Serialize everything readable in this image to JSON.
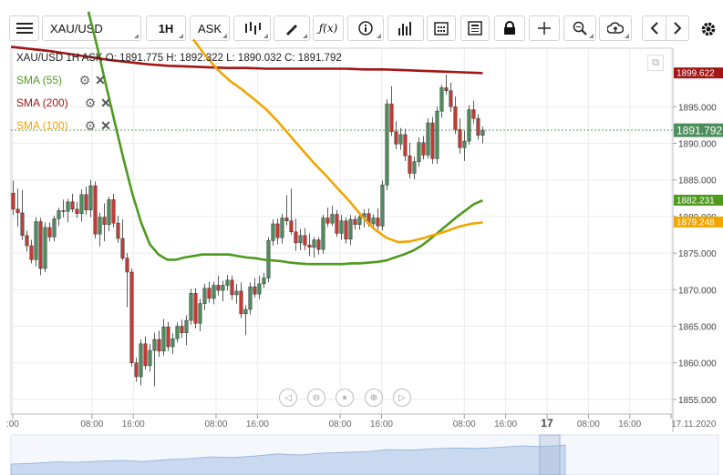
{
  "toolbar": {
    "symbol": "XAU/USD",
    "timeframe": "1H",
    "price_type": "ASK"
  },
  "ohlc_line": "XAU/USD 1H ASK  O: 1891.775 H: 1892.322 L: 1890.032 C: 1891.792",
  "legend": [
    {
      "name": "SMA (55)",
      "color": "#4e9a1e"
    },
    {
      "name": "SMA (200)",
      "color": "#a31515"
    },
    {
      "name": "SMA (100)",
      "color": "#f0a500"
    }
  ],
  "chart_data": {
    "type": "candlestick",
    "title": "XAU/USD 1H ASK",
    "ylim": [
      1853,
      1903
    ],
    "y_ticks": [
      1855,
      1860,
      1865,
      1870,
      1875,
      1880,
      1885,
      1890,
      1895
    ],
    "y_tick_labels": [
      "1855.000",
      "1860.000",
      "1865.000",
      "1870.000",
      "1875.000",
      "1880.000",
      "1885.000",
      "1890.000",
      "1895.000"
    ],
    "x_tick_labels": [
      ":00",
      "08:00",
      "16:00",
      "08:00",
      "16:00",
      "08:00",
      "16:00",
      "08:00",
      "16:00",
      "17",
      "08:00",
      "16:00",
      "17.11.2020"
    ],
    "x_tick_index": [
      0,
      23,
      35,
      59,
      71,
      95,
      107,
      131,
      143,
      155,
      167,
      179,
      191
    ],
    "bars_visible": 192,
    "up_color": "#4e8e5c",
    "down_color": "#c43b33",
    "candles": [
      [
        1883.2,
        1884.9,
        1880.2,
        1881.0
      ],
      [
        1881.0,
        1883.8,
        1878.6,
        1880.5
      ],
      [
        1880.5,
        1883.6,
        1876.8,
        1877.4
      ],
      [
        1877.4,
        1878.1,
        1875.2,
        1876.0
      ],
      [
        1876.0,
        1876.8,
        1873.6,
        1874.1
      ],
      [
        1874.1,
        1879.9,
        1873.2,
        1879.3
      ],
      [
        1879.3,
        1879.8,
        1872.0,
        1872.9
      ],
      [
        1872.9,
        1879.2,
        1872.4,
        1878.5
      ],
      [
        1878.5,
        1879.2,
        1876.6,
        1877.2
      ],
      [
        1877.2,
        1880.1,
        1876.6,
        1879.7
      ],
      [
        1879.7,
        1881.2,
        1878.7,
        1880.8
      ],
      [
        1880.8,
        1882.3,
        1879.9,
        1880.7
      ],
      [
        1880.7,
        1882.4,
        1879.2,
        1882.0
      ],
      [
        1882.0,
        1883.1,
        1880.6,
        1881.0
      ],
      [
        1881.0,
        1882.0,
        1879.8,
        1880.4
      ],
      [
        1880.4,
        1883.7,
        1879.3,
        1883.0
      ],
      [
        1883.0,
        1884.1,
        1880.2,
        1880.9
      ],
      [
        1880.9,
        1885.0,
        1879.9,
        1884.2
      ],
      [
        1884.2,
        1884.8,
        1877.0,
        1877.6
      ],
      [
        1877.6,
        1880.5,
        1875.9,
        1879.9
      ],
      [
        1879.9,
        1881.8,
        1876.6,
        1878.9
      ],
      [
        1878.9,
        1882.7,
        1878.0,
        1882.3
      ],
      [
        1882.3,
        1883.1,
        1878.5,
        1879.1
      ],
      [
        1879.1,
        1880.1,
        1876.4,
        1877.0
      ],
      [
        1877.0,
        1879.6,
        1874.0,
        1874.3
      ],
      [
        1874.3,
        1875.0,
        1867.6,
        1872.4
      ],
      [
        1872.4,
        1872.9,
        1859.5,
        1860.0
      ],
      [
        1860.0,
        1860.7,
        1857.4,
        1858.1
      ],
      [
        1858.1,
        1863.2,
        1856.9,
        1862.6
      ],
      [
        1862.6,
        1863.6,
        1859.1,
        1859.6
      ],
      [
        1859.6,
        1862.6,
        1858.8,
        1861.7
      ],
      [
        1861.7,
        1864.1,
        1856.8,
        1863.2
      ],
      [
        1863.2,
        1864.4,
        1860.8,
        1861.6
      ],
      [
        1861.6,
        1866.0,
        1861.0,
        1864.9
      ],
      [
        1864.9,
        1865.6,
        1861.6,
        1862.2
      ],
      [
        1862.2,
        1864.0,
        1861.2,
        1863.3
      ],
      [
        1863.3,
        1865.5,
        1862.8,
        1865.0
      ],
      [
        1865.0,
        1865.9,
        1863.4,
        1864.1
      ],
      [
        1864.1,
        1866.5,
        1862.4,
        1865.8
      ],
      [
        1865.8,
        1870.1,
        1865.2,
        1869.5
      ],
      [
        1869.5,
        1870.2,
        1864.7,
        1865.4
      ],
      [
        1865.4,
        1868.8,
        1864.3,
        1868.1
      ],
      [
        1868.1,
        1870.8,
        1867.2,
        1870.2
      ],
      [
        1870.2,
        1871.1,
        1868.2,
        1868.8
      ],
      [
        1868.8,
        1871.1,
        1868.0,
        1870.6
      ],
      [
        1870.6,
        1871.9,
        1869.2,
        1869.9
      ],
      [
        1869.9,
        1871.2,
        1868.4,
        1870.6
      ],
      [
        1870.6,
        1872.0,
        1869.9,
        1871.3
      ],
      [
        1871.3,
        1871.9,
        1868.6,
        1869.3
      ],
      [
        1869.3,
        1870.8,
        1868.1,
        1869.8
      ],
      [
        1869.8,
        1871.0,
        1866.1,
        1866.7
      ],
      [
        1866.7,
        1867.9,
        1863.8,
        1867.3
      ],
      [
        1867.3,
        1871.0,
        1866.6,
        1870.4
      ],
      [
        1870.4,
        1871.6,
        1868.9,
        1869.4
      ],
      [
        1869.4,
        1871.9,
        1868.7,
        1870.8
      ],
      [
        1870.8,
        1872.3,
        1870.2,
        1871.6
      ],
      [
        1871.6,
        1877.2,
        1871.0,
        1876.7
      ],
      [
        1876.7,
        1879.6,
        1876.0,
        1879.0
      ],
      [
        1879.0,
        1879.7,
        1876.2,
        1877.1
      ],
      [
        1877.1,
        1880.4,
        1876.3,
        1879.8
      ],
      [
        1879.8,
        1882.9,
        1878.8,
        1879.4
      ],
      [
        1879.4,
        1883.8,
        1877.5,
        1877.9
      ],
      [
        1877.9,
        1879.7,
        1875.3,
        1876.4
      ],
      [
        1876.4,
        1878.3,
        1875.4,
        1877.4
      ],
      [
        1877.4,
        1878.4,
        1875.4,
        1876.1
      ],
      [
        1876.1,
        1877.7,
        1874.6,
        1875.8
      ],
      [
        1875.8,
        1877.2,
        1874.4,
        1876.8
      ],
      [
        1876.8,
        1877.2,
        1874.8,
        1875.5
      ],
      [
        1875.5,
        1880.2,
        1874.9,
        1879.8
      ],
      [
        1879.8,
        1881.2,
        1878.6,
        1879.1
      ],
      [
        1879.1,
        1881.5,
        1878.7,
        1880.3
      ],
      [
        1880.3,
        1880.9,
        1877.2,
        1877.7
      ],
      [
        1877.7,
        1880.2,
        1876.8,
        1879.4
      ],
      [
        1879.4,
        1879.9,
        1876.3,
        1876.9
      ],
      [
        1876.9,
        1880.2,
        1876.1,
        1879.6
      ],
      [
        1879.6,
        1880.1,
        1878.2,
        1878.9
      ],
      [
        1878.9,
        1880.6,
        1878.2,
        1879.9
      ],
      [
        1879.9,
        1881.0,
        1878.5,
        1880.4
      ],
      [
        1880.4,
        1881.1,
        1878.6,
        1879.0
      ],
      [
        1879.0,
        1880.3,
        1878.5,
        1879.8
      ],
      [
        1879.8,
        1881.1,
        1878.2,
        1878.7
      ],
      [
        1878.7,
        1884.9,
        1878.1,
        1884.3
      ],
      [
        1884.3,
        1896.0,
        1883.6,
        1895.4
      ],
      [
        1895.4,
        1897.8,
        1891.0,
        1891.6
      ],
      [
        1891.6,
        1893.0,
        1889.2,
        1889.9
      ],
      [
        1889.9,
        1892.1,
        1889.1,
        1891.2
      ],
      [
        1891.2,
        1892.0,
        1887.6,
        1888.3
      ],
      [
        1888.3,
        1890.1,
        1885.2,
        1885.9
      ],
      [
        1885.9,
        1888.2,
        1885.1,
        1887.5
      ],
      [
        1887.5,
        1890.8,
        1886.8,
        1890.1
      ],
      [
        1890.1,
        1891.0,
        1887.8,
        1888.4
      ],
      [
        1888.4,
        1893.4,
        1887.9,
        1892.8
      ],
      [
        1892.8,
        1893.6,
        1887.2,
        1887.9
      ],
      [
        1887.9,
        1895.0,
        1887.2,
        1894.4
      ],
      [
        1894.4,
        1898.0,
        1893.5,
        1897.6
      ],
      [
        1897.6,
        1899.4,
        1896.7,
        1897.2
      ],
      [
        1897.2,
        1898.3,
        1894.3,
        1895.0
      ],
      [
        1895.0,
        1896.4,
        1891.3,
        1891.9
      ],
      [
        1891.9,
        1893.4,
        1888.6,
        1889.4
      ],
      [
        1889.4,
        1891.7,
        1887.6,
        1890.3
      ],
      [
        1890.3,
        1895.2,
        1889.8,
        1894.6
      ],
      [
        1894.6,
        1895.8,
        1892.7,
        1893.4
      ],
      [
        1893.4,
        1894.0,
        1890.5,
        1891.1
      ],
      [
        1891.1,
        1892.3,
        1890.0,
        1891.8
      ]
    ],
    "series": [
      {
        "name": "SMA (55)",
        "color": "#4e9a1e",
        "values": [
          1908.0,
          1903.2,
          1898.0,
          1892.9,
          1887.9,
          1883.2,
          1879.2,
          1876.2,
          1874.8,
          1874.1,
          1874.1,
          1874.4,
          1874.6,
          1874.8,
          1874.8,
          1874.8,
          1874.8,
          1874.6,
          1874.4,
          1874.3,
          1874.1,
          1874.0,
          1873.9,
          1873.7,
          1873.6,
          1873.5,
          1873.5,
          1873.5,
          1873.5,
          1873.5,
          1873.6,
          1873.6,
          1873.7,
          1873.8,
          1874.0,
          1874.4,
          1874.8,
          1875.3,
          1876.0,
          1876.9,
          1877.9,
          1878.9,
          1879.9,
          1880.8,
          1881.7,
          1882.2
        ]
      },
      {
        "name": "SMA (200)",
        "color": "#a31515",
        "values": [
          1903.2,
          1902.9,
          1902.6,
          1902.2,
          1901.8,
          1901.4,
          1901.1,
          1900.8,
          1900.6,
          1900.5,
          1900.4,
          1900.3,
          1900.3,
          1900.2,
          1900.2,
          1900.2,
          1900.2,
          1900.2,
          1900.1,
          1900.1,
          1900.0,
          1899.9,
          1899.8,
          1899.7,
          1899.6
        ]
      },
      {
        "name": "SMA (100)",
        "color": "#f0a500",
        "values": [
          1904.2,
          1902.0,
          1900.1,
          1898.6,
          1897.4,
          1896.1,
          1894.7,
          1893.0,
          1891.1,
          1889.2,
          1887.3,
          1885.6,
          1883.8,
          1882.0,
          1880.0,
          1878.3,
          1877.1,
          1876.5,
          1876.6,
          1877.0,
          1877.5,
          1878.0,
          1878.6,
          1879.0,
          1879.2
        ]
      }
    ],
    "last_value_labels": [
      {
        "text": "1899.622",
        "value": 1899.622,
        "bg": "#a31515"
      },
      {
        "text": "1891.792",
        "value": 1891.792,
        "bg": "#4e8e5c"
      },
      {
        "text": "1882.231",
        "value": 1882.231,
        "bg": "#4e9a1e"
      },
      {
        "text": "1879.248",
        "value": 1879.248,
        "bg": "#f0a500"
      }
    ],
    "grid": true
  },
  "icons": [
    "menu-icon",
    "indicators-icon",
    "draw-icon",
    "function-icon",
    "info-icon",
    "volume-bars-icon",
    "calendar-icon",
    "news-icon",
    "lock-icon",
    "crosshair-icon",
    "zoom-icon",
    "cloud-upload-icon",
    "prev-icon",
    "next-icon",
    "settings-icon"
  ]
}
